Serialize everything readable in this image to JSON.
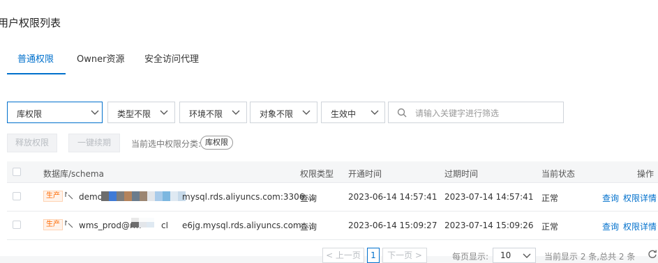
{
  "page": {
    "title": "用户权限列表"
  },
  "tabs": [
    {
      "label": "普通权限",
      "active": true
    },
    {
      "label": "Owner资源",
      "active": false
    },
    {
      "label": "安全访问代理",
      "active": false
    }
  ],
  "filters": {
    "category": "库权限",
    "type": "类型不限",
    "env": "环境不限",
    "object": "对象不限",
    "status": "生效中",
    "search_placeholder": "请输入关键字进行筛选"
  },
  "actions": {
    "release": "释放权限",
    "renew": "一键续期",
    "current_category_label": "当前选中权限分类:",
    "current_category_value": "库权限"
  },
  "table": {
    "headers": {
      "db": "数据库/schema",
      "perm_type": "权限类型",
      "open_time": "开通时间",
      "expire_time": "过期时间",
      "status": "当前状态",
      "ops": "操作"
    },
    "rows": [
      {
        "env_tag": "生产",
        "db_prefix": "demo",
        "db_suffix": "mysql.rds.aliyuncs.com:3306 ...",
        "perm_type": "查询",
        "open_time": "2023-06-14 14:57:41",
        "expire_time": "2023-07-14 14:57:41",
        "status": "正常",
        "op_query": "查询",
        "op_detail": "权限详情"
      },
      {
        "env_tag": "生产",
        "db_prefix": "wms_prod@rm",
        "db_mid": "cl",
        "db_suffix": "e6jg.mysql.rds.aliyuncs.com:...",
        "perm_type": "查询",
        "open_time": "2023-06-14 15:09:27",
        "expire_time": "2023-07-14 15:09:26",
        "status": "正常",
        "op_query": "查询",
        "op_detail": "权限详情"
      }
    ]
  },
  "pagination": {
    "prev": "< 上一页",
    "current_page": "1",
    "next": "下一页 >",
    "page_size_label": "每页显示:",
    "page_size": "10",
    "summary": "当前显示 2 条,总共 2 条"
  },
  "colors": {
    "accent": "#0070cc",
    "prod_tag": "#ff6a00"
  }
}
